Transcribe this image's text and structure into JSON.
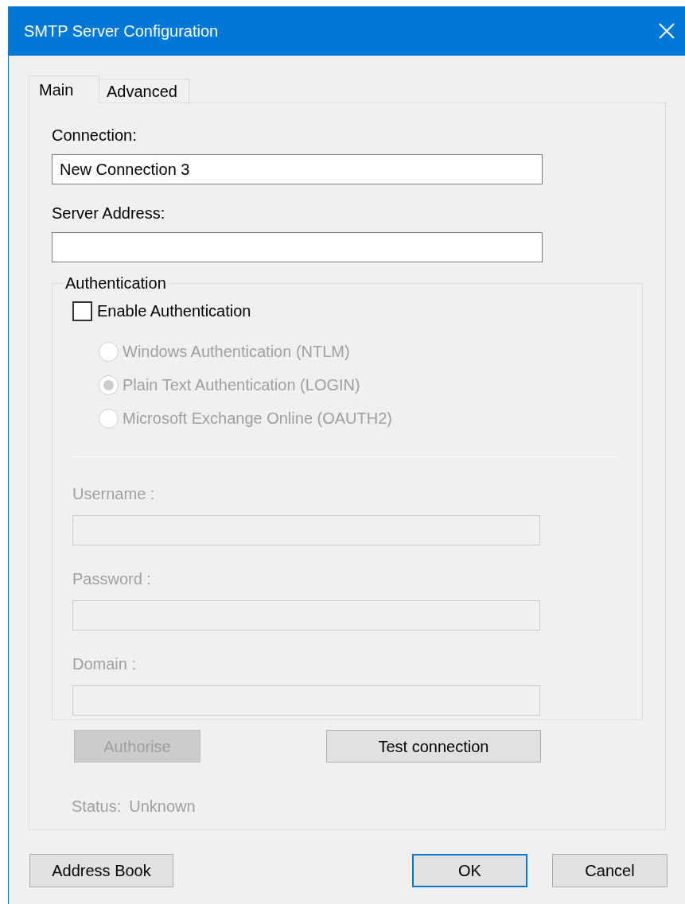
{
  "window": {
    "title": "SMTP Server Configuration"
  },
  "tabs": [
    {
      "label": "Main",
      "selected": true
    },
    {
      "label": "Advanced",
      "selected": false
    }
  ],
  "fields": [
    {
      "label": "Connection:",
      "value": "New Connection 3"
    },
    {
      "label": "Server Address:"
    }
  ],
  "authentication": {
    "title": "Authentication",
    "enable": {
      "label": "Enable Authentication",
      "checked": false
    },
    "options": [
      {
        "label": "Windows Authentication (NTLM)",
        "selected": false,
        "disabled": true
      },
      {
        "label": "Plain Text Authentication (LOGIN)",
        "selected": true,
        "disabled": true
      },
      {
        "label": "Microsoft Exchange Online (OAUTH2)",
        "selected": false,
        "disabled": true
      }
    ],
    "credentials": [
      {
        "label": "Username :",
        "disabled": true
      },
      {
        "label": "Password :",
        "disabled": true
      },
      {
        "label": "Domain :",
        "disabled": true
      }
    ]
  },
  "actions": [
    {
      "label": "Authorise",
      "disabled": true
    },
    {
      "label": "Test connection",
      "disabled": false
    }
  ],
  "status": {
    "label": "Status:",
    "value": "Unknown",
    "disabled": true
  },
  "footer_buttons": [
    {
      "label": "Address Book",
      "default": false
    },
    {
      "label": "OK",
      "default": true
    },
    {
      "label": "Cancel",
      "default": false
    }
  ]
}
